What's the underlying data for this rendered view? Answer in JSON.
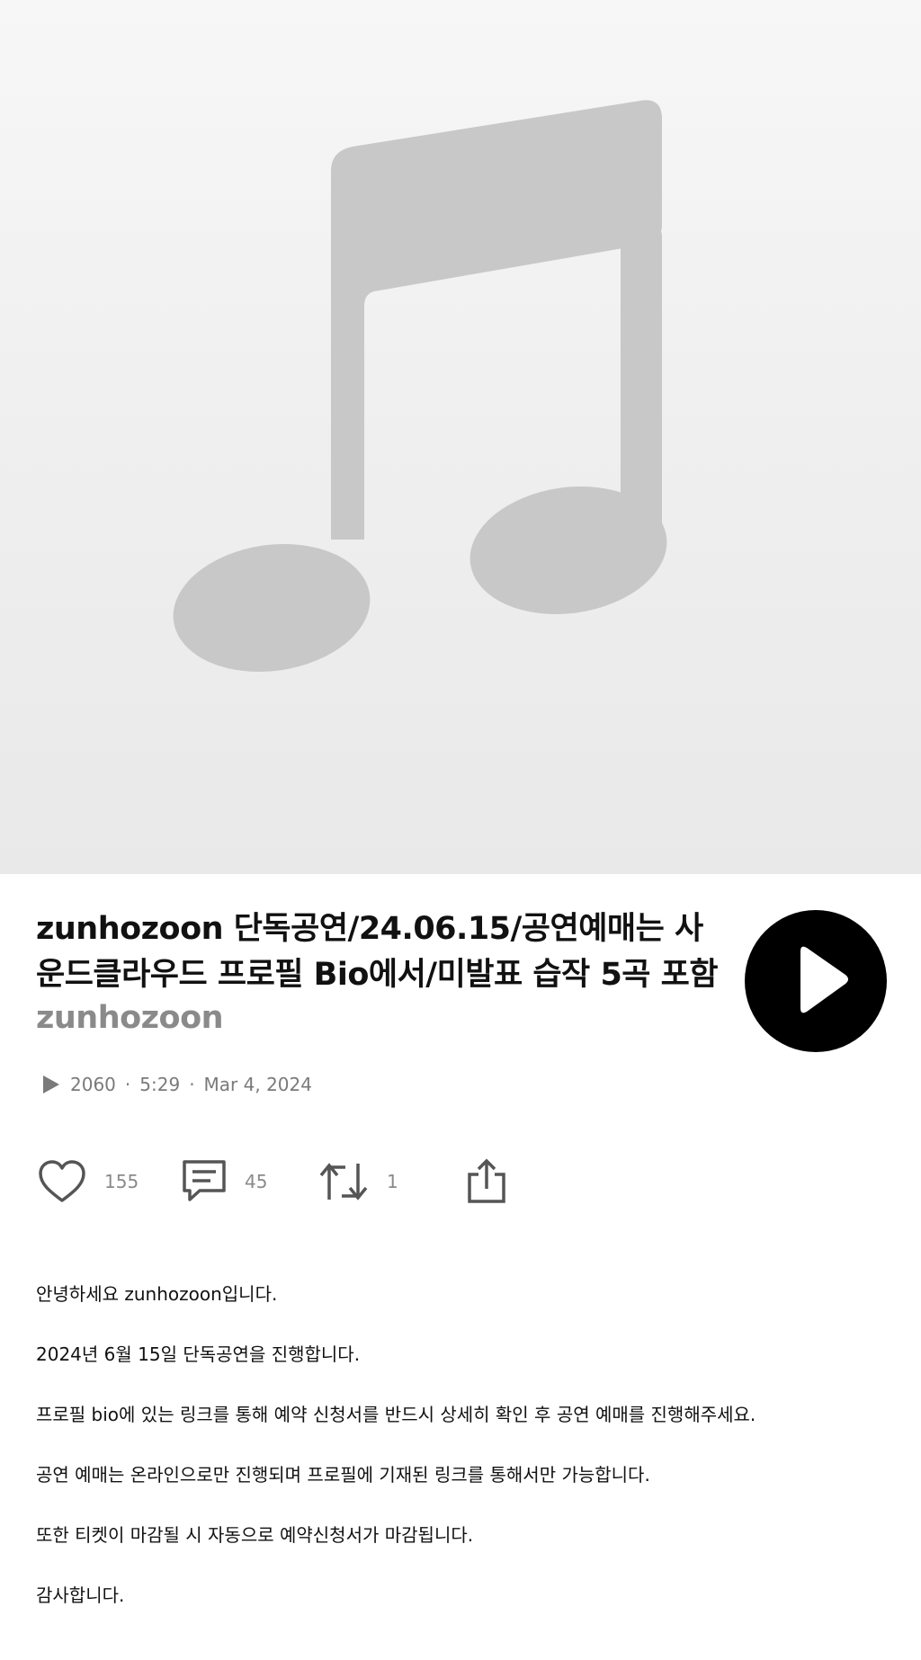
{
  "track": {
    "title": "zunhozoon 단독공연/24.06.15/공연예매는 사운드클라우드 프로필 Bio에서/미발표 습작 5곡 포함",
    "artist": "zunhozoon",
    "plays": "2060",
    "duration": "5:29",
    "date": "Mar 4, 2024",
    "separator": "·"
  },
  "artwork": {
    "icon": "music-note-icon",
    "background": "#f0f0f0",
    "note_color": "#c8c8c8"
  },
  "actions": {
    "likes": "155",
    "comments": "45",
    "reposts": "1"
  },
  "description": [
    "안녕하세요 zunhozoon입니다.",
    "2024년 6월 15일 단독공연을 진행합니다.",
    "프로필 bio에 있는 링크를 통해 예약 신청서를 반드시 상세히 확인 후 공연 예매를 진행해주세요.",
    "공연 예매는 온라인으로만 진행되며 프로필에 기재된 링크를 통해서만 가능합니다.",
    "또한 티켓이 마감될 시 자동으로 예약신청서가 마감됩니다.",
    "감사합니다."
  ],
  "colors": {
    "play_button": "#000000",
    "muted_text": "#8a8a8a"
  }
}
